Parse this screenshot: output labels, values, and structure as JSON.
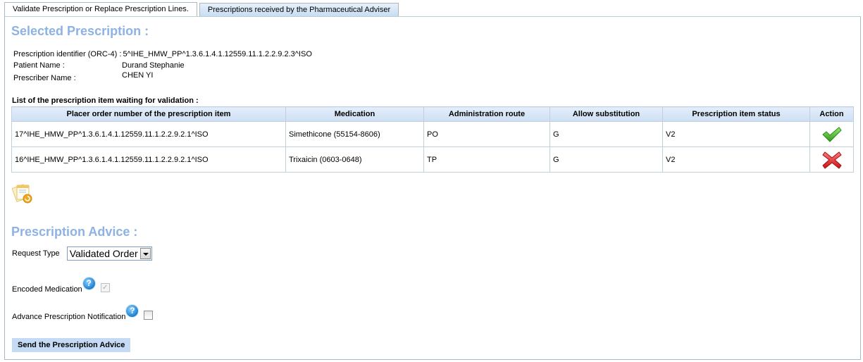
{
  "tabs": [
    {
      "label": "Validate Prescription or Replace Prescription Lines.",
      "active": true
    },
    {
      "label": "Prescriptions received by the Pharmaceutical Adviser",
      "active": false
    }
  ],
  "selected_prescription": {
    "title": "Selected Prescription :",
    "fields": [
      {
        "label": "Prescription identifier (ORC-4) :",
        "value": "5^IHE_HMW_PP^1.3.6.1.4.1.12559.11.1.2.2.9.2.3^ISO"
      },
      {
        "label": "Patient Name :",
        "value": "Durand Stephanie"
      },
      {
        "label": "Prescriber Name :",
        "value": "CHEN YI"
      }
    ]
  },
  "items_table": {
    "title": "List of the prescription item waiting for validation :",
    "columns": [
      "Placer order number of the prescription item",
      "Medication",
      "Administration route",
      "Allow substitution",
      "Prescription item status",
      "Action"
    ],
    "rows": [
      {
        "placer_order": "17^IHE_HMW_PP^1.3.6.1.4.1.12559.11.1.2.2.9.2.1^ISO",
        "medication": "Simethicone (55154-8606)",
        "route": "PO",
        "substitution": "G",
        "status": "V2",
        "action_icon": "check-icon"
      },
      {
        "placer_order": "16^IHE_HMW_PP^1.3.6.1.4.1.12559.11.1.2.2.9.2.1^ISO",
        "medication": "Trixaicin (0603-0648)",
        "route": "TP",
        "substitution": "G",
        "status": "V2",
        "action_icon": "cross-icon"
      }
    ]
  },
  "advice": {
    "title": "Prescription Advice :",
    "request_type_label": "Request Type",
    "request_type_value": "Validated Order",
    "encoded_medication_label": "Encoded Medication",
    "encoded_medication_checked": true,
    "encoded_medication_disabled": true,
    "advance_notification_label": "Advance Prescription Notification",
    "advance_notification_checked": false,
    "help_icon_text": "?",
    "send_button": "Send the Prescription Advice"
  },
  "colors": {
    "section_title": "#8db2e3",
    "button_bg": "#c4daf5",
    "check_green": "#3fae2a",
    "cross_red": "#e02020"
  }
}
